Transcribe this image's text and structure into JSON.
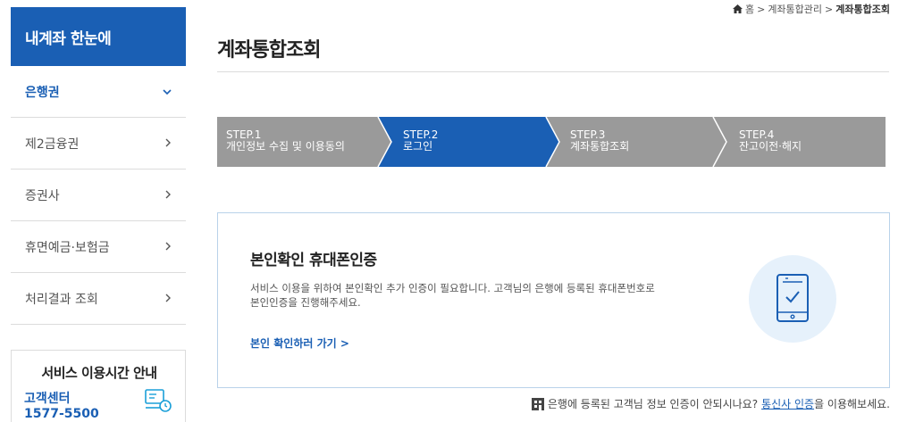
{
  "sidebar": {
    "title": "내계좌 한눈에",
    "items": [
      {
        "label": "은행권",
        "icon": "chevron-down-icon",
        "active": true
      },
      {
        "label": "제2금융권",
        "icon": "chevron-right-icon"
      },
      {
        "label": "증권사",
        "icon": "chevron-right-icon"
      },
      {
        "label": "휴면예금·보험금",
        "icon": "chevron-right-icon"
      },
      {
        "label": "처리결과 조회",
        "icon": "chevron-right-icon"
      }
    ],
    "service": {
      "title": "서비스 이용시간 안내",
      "center_label": "고객센터",
      "center_phone": "1577-5500"
    }
  },
  "breadcrumb": {
    "items": [
      "홈",
      "계좌통합관리",
      "계좌통합조회"
    ],
    "separator": ">"
  },
  "page": {
    "title": "계좌통합조회"
  },
  "steps": [
    {
      "num": "STEP.1",
      "label": "개인정보 수집 및 이용동의",
      "active": false
    },
    {
      "num": "STEP.2",
      "label": "로그인",
      "active": true
    },
    {
      "num": "STEP.3",
      "label": "계좌통합조회",
      "active": false
    },
    {
      "num": "STEP.4",
      "label": "잔고이전·해지",
      "active": false
    }
  ],
  "colors": {
    "primary": "#1a5fb4",
    "step_inactive": "#9a9a9a",
    "card_border": "#b9d2ea",
    "icon_circle": "#e6f1fb"
  },
  "card": {
    "title": "본인확인 휴대폰인증",
    "desc_line1": "서비스 이용을 위하여 본인확인 추가 인증이 필요합니다. 고객님의 은행에 등록된 휴대폰번호로",
    "desc_line2": "본인인증을 진행해주세요.",
    "link": "본인 확인하러 가기 >",
    "icon": "phone-check-icon"
  },
  "note": {
    "text_before": "은행에 등록된 고객님 정보 인증이 안되시나요?",
    "link": "통신사 인증",
    "text_after": "을 이용해보세요."
  }
}
